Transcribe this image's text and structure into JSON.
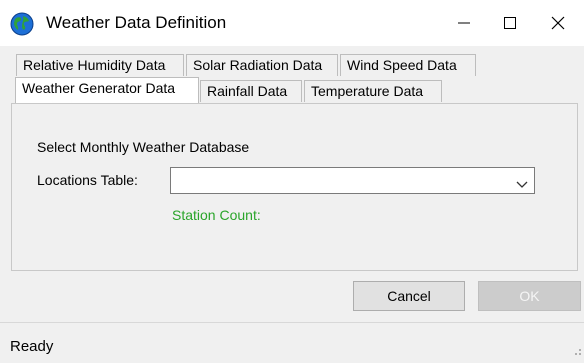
{
  "window": {
    "title": "Weather Data Definition",
    "icon": "globe-icon",
    "controls": [
      "minimize-icon",
      "maximize-icon",
      "close-icon"
    ]
  },
  "tabs": {
    "row1": [
      {
        "label": "Relative Humidity Data"
      },
      {
        "label": "Solar Radiation Data"
      },
      {
        "label": "Wind Speed Data"
      }
    ],
    "row2": [
      {
        "label": "Weather Generator Data",
        "active": true
      },
      {
        "label": "Rainfall Data"
      },
      {
        "label": "Temperature Data"
      }
    ]
  },
  "panel": {
    "heading": "Select Monthly Weather Database",
    "locations_label": "Locations Table:",
    "locations_value": "",
    "station_count_label": "Station Count:"
  },
  "buttons": {
    "cancel": "Cancel",
    "ok": "OK"
  },
  "status": {
    "text": "Ready"
  },
  "colors": {
    "station_count": "#2aa52a",
    "disabled_button": "#cccccc"
  }
}
